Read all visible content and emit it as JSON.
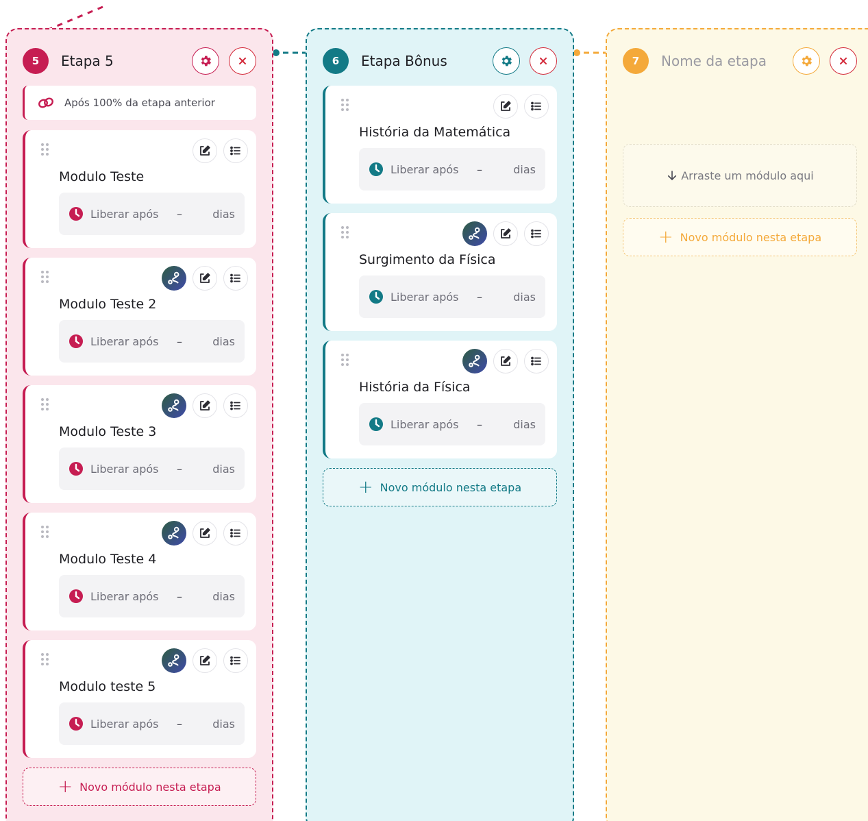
{
  "colors": {
    "pink": "#c61d52",
    "teal": "#137a86",
    "amber": "#f4a93a",
    "close": "#d32a3a"
  },
  "stages": [
    {
      "number": "5",
      "title": "Etapa 5",
      "rule": "Após 100% da etapa anterior",
      "modules": [
        {
          "title": "Modulo Teste",
          "release_label": "Liberar após",
          "release_value": "–",
          "release_unit": "dias",
          "has_route": false
        },
        {
          "title": "Modulo Teste 2",
          "release_label": "Liberar após",
          "release_value": "–",
          "release_unit": "dias",
          "has_route": true
        },
        {
          "title": "Modulo Teste 3",
          "release_label": "Liberar após",
          "release_value": "–",
          "release_unit": "dias",
          "has_route": true
        },
        {
          "title": "Modulo Teste 4",
          "release_label": "Liberar após",
          "release_value": "–",
          "release_unit": "dias",
          "has_route": true
        },
        {
          "title": "Modulo teste 5",
          "release_label": "Liberar após",
          "release_value": "–",
          "release_unit": "dias",
          "has_route": true
        }
      ],
      "new_module_label": "Novo módulo nesta etapa"
    },
    {
      "number": "6",
      "title": "Etapa Bônus",
      "modules": [
        {
          "title": "História da Matemática",
          "release_label": "Liberar após",
          "release_value": "–",
          "release_unit": "dias",
          "has_route": false
        },
        {
          "title": "Surgimento da Física",
          "release_label": "Liberar após",
          "release_value": "–",
          "release_unit": "dias",
          "has_route": true
        },
        {
          "title": "História da Física",
          "release_label": "Liberar após",
          "release_value": "–",
          "release_unit": "dias",
          "has_route": true
        }
      ],
      "new_module_label": "Novo módulo nesta etapa"
    },
    {
      "number": "7",
      "title": "Nome da etapa",
      "dropzone_label": "Arraste um módulo aqui",
      "new_module_label": "Novo módulo nesta etapa"
    }
  ]
}
